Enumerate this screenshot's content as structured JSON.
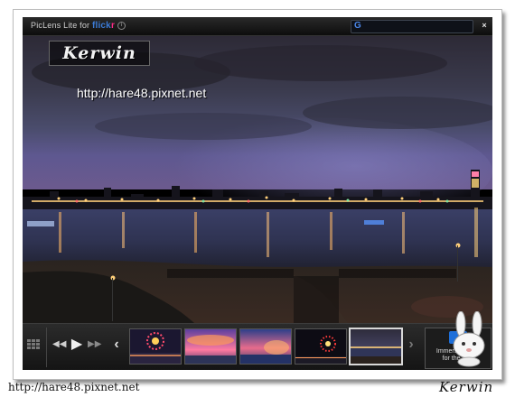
{
  "app": {
    "title_prefix": "PicLens Lite for ",
    "title_brand_a": "flick",
    "title_brand_b": "r",
    "search_logo": "G",
    "search_placeholder": "",
    "close_label": "×"
  },
  "watermark": {
    "logo_text": "Kerwin",
    "url": "http://hare48.pixnet.net"
  },
  "filmstrip": {
    "thumbnails": [
      {
        "subject": "fireworks over river",
        "selected": false
      },
      {
        "subject": "sunset clouds over sea",
        "selected": false
      },
      {
        "subject": "sunset over water",
        "selected": false
      },
      {
        "subject": "fireworks at night",
        "selected": false
      },
      {
        "subject": "night city skyline",
        "selected": true
      }
    ],
    "immersive_label_1": "Immersive view",
    "immersive_label_2": "for the web"
  },
  "footer": {
    "url": "http://hare48.pixnet.net",
    "signature": "Kerwin"
  },
  "colors": {
    "flickr_blue": "#3b7bd6",
    "flickr_pink": "#ff2b87",
    "google_blue": "#4a86e8",
    "immersive_blue": "#1e6fd9"
  }
}
